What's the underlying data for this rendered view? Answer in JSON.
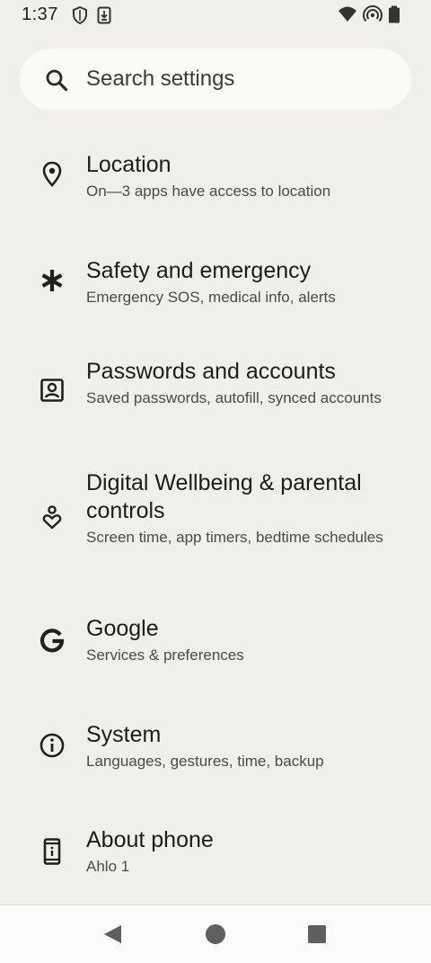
{
  "status_bar": {
    "time": "1:37"
  },
  "search": {
    "placeholder": "Search settings",
    "icon": "search-icon"
  },
  "settings": [
    {
      "title": "Location",
      "summary": "On—3 apps have access to location",
      "icon": "location-pin-icon"
    },
    {
      "title": "Safety and emergency",
      "summary": "Emergency SOS, medical info, alerts",
      "icon": "asterisk-icon"
    },
    {
      "title": "Passwords and accounts",
      "summary": "Saved passwords, autofill, synced accounts",
      "icon": "account-box-icon"
    },
    {
      "title": "Digital Wellbeing & parental controls",
      "summary": "Screen time, app timers, bedtime schedules",
      "icon": "wellbeing-icon"
    },
    {
      "title": "Google",
      "summary": "Services & preferences",
      "icon": "google-g-icon"
    },
    {
      "title": "System",
      "summary": "Languages, gestures, time, backup",
      "icon": "info-icon"
    },
    {
      "title": "About phone",
      "summary": "Ahlo 1",
      "icon": "phone-icon"
    }
  ],
  "nav": {
    "back_icon": "back-triangle-icon",
    "home_icon": "home-circle-icon",
    "recents_icon": "recents-square-icon"
  },
  "colors": {
    "background": "#f0efeb",
    "search_bg": "#fafaf7",
    "title_text": "#1c1c1c",
    "summary_text": "#4a4a4a"
  }
}
